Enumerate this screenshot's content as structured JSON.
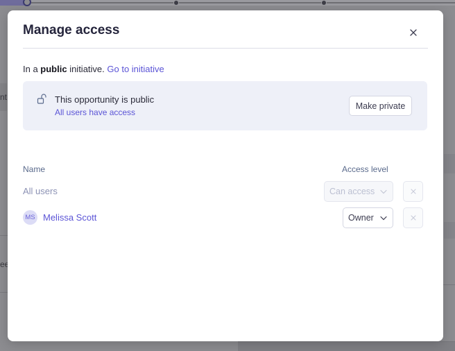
{
  "modal": {
    "title": "Manage access",
    "context": {
      "prefix": "In a ",
      "visibility": "public",
      "suffix": " initiative. ",
      "link": "Go to initiative"
    },
    "public_notice": {
      "title": "This opportunity is public",
      "subtitle": "All users have access",
      "action_label": "Make private"
    },
    "table": {
      "headers": {
        "name": "Name",
        "access": "Access level"
      },
      "rows": [
        {
          "name": "All users",
          "access": "Can access",
          "disabled": true
        },
        {
          "initials": "MS",
          "name": "Melissa Scott",
          "access": "Owner",
          "disabled": false
        }
      ]
    }
  },
  "backdrop": {
    "side_text_1": "nt",
    "side_text_2": "ee"
  },
  "colors": {
    "accent": "#5b54d6",
    "title": "#25253c",
    "notice_bg": "#eef0f8",
    "overlay": "#8c8c90"
  },
  "icons": [
    "close-icon",
    "unlock-icon",
    "chevron-down-icon",
    "remove-icon"
  ]
}
